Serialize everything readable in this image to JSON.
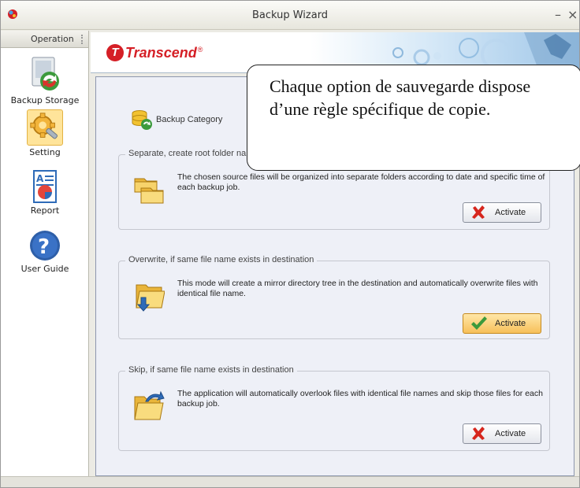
{
  "window": {
    "title": "Backup Wizard",
    "minimize_label": "–",
    "close_label": "×"
  },
  "sidebar": {
    "header": "Operation",
    "items": [
      {
        "label": "Backup Storage",
        "icon": "backup-storage-icon"
      },
      {
        "label": "Setting",
        "icon": "setting-icon",
        "active": true
      },
      {
        "label": "Report",
        "icon": "report-icon"
      },
      {
        "label": "User Guide",
        "icon": "user-guide-icon"
      }
    ]
  },
  "banner": {
    "logo_text": "Transcend",
    "logo_reg": "®",
    "logo_mark": "T"
  },
  "main": {
    "category_label": "Backup Category",
    "groups": [
      {
        "legend": "Separate, create root folder nar",
        "description": "The chosen source files will be organized into separate folders according to date and specific time of each backup job.",
        "button_label": "Activate",
        "active": false
      },
      {
        "legend": "Overwrite, if same file name exists in destination",
        "description": "This mode will create a mirror directory tree in the destination and automatically overwrite files with identical file name.",
        "button_label": "Activate",
        "active": true
      },
      {
        "legend": "Skip, if same file name exists in destination",
        "description": "The application will automatically overlook files with identical file names and skip those files for each backup job.",
        "button_label": "Activate",
        "active": false
      }
    ]
  },
  "callout": {
    "text": "Chaque option de sauvegarde dispose d’une règle spécifique de copie."
  },
  "colors": {
    "brand_red": "#d51f26",
    "active_button": "#f7c05a",
    "content_bg": "#eef0f7"
  }
}
